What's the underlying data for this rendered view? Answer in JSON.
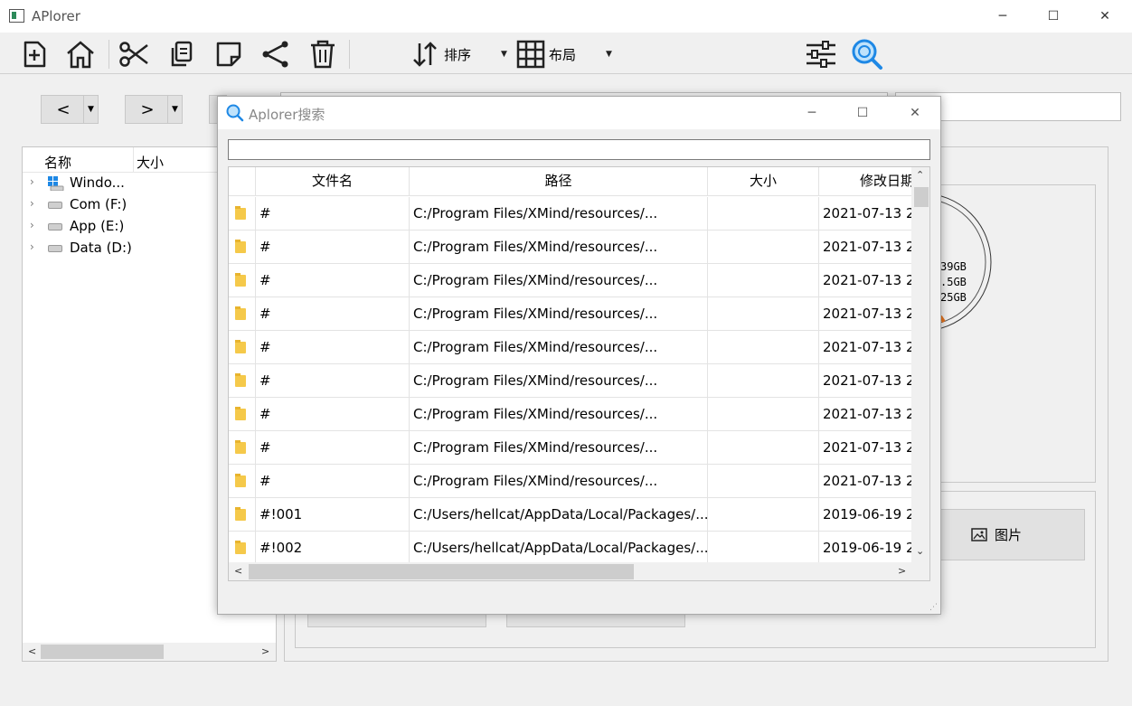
{
  "window": {
    "title": "APlorer",
    "minimize": "─",
    "maximize": "☐",
    "close": "✕"
  },
  "toolbar": {
    "icons": [
      "new-file-icon",
      "home-icon",
      "cut-icon",
      "copy-icon",
      "note-icon",
      "share-icon",
      "delete-icon",
      "sort-icon",
      "layout-grid-icon",
      "filter-settings-icon",
      "search-icon"
    ],
    "sort_label": "排序",
    "layout_label": "布局",
    "dropdown_glyph": "▼"
  },
  "nav": {
    "back": "<",
    "forward": ">",
    "dropdown_glyph": "▼"
  },
  "tree": {
    "headers": [
      "名称",
      "大小"
    ],
    "items": [
      {
        "label": "Windo...",
        "icon": "windows-drive-icon"
      },
      {
        "label": "Com (F:)",
        "icon": "drive-icon"
      },
      {
        "label": "App (E:)",
        "icon": "drive-icon"
      },
      {
        "label": "Data (D:)",
        "icon": "drive-icon"
      }
    ],
    "expand_glyph": "›"
  },
  "disk": {
    "values": [
      "39GB",
      ".5GB",
      "25GB"
    ]
  },
  "pictures_button": "图片",
  "search_dialog": {
    "title": "Aplorer搜索",
    "query": "",
    "columns": [
      "文件名",
      "路径",
      "大小",
      "修改日期"
    ],
    "rows": [
      {
        "name": "#",
        "path": "C:/Program Files/XMind/resources/...",
        "size": "",
        "date": "2021-07-13 2"
      },
      {
        "name": "#",
        "path": "C:/Program Files/XMind/resources/...",
        "size": "",
        "date": "2021-07-13 2"
      },
      {
        "name": "#",
        "path": "C:/Program Files/XMind/resources/...",
        "size": "",
        "date": "2021-07-13 2"
      },
      {
        "name": "#",
        "path": "C:/Program Files/XMind/resources/...",
        "size": "",
        "date": "2021-07-13 2"
      },
      {
        "name": "#",
        "path": "C:/Program Files/XMind/resources/...",
        "size": "",
        "date": "2021-07-13 2"
      },
      {
        "name": "#",
        "path": "C:/Program Files/XMind/resources/...",
        "size": "",
        "date": "2021-07-13 2"
      },
      {
        "name": "#",
        "path": "C:/Program Files/XMind/resources/...",
        "size": "",
        "date": "2021-07-13 2"
      },
      {
        "name": "#",
        "path": "C:/Program Files/XMind/resources/...",
        "size": "",
        "date": "2021-07-13 2"
      },
      {
        "name": "#",
        "path": "C:/Program Files/XMind/resources/...",
        "size": "",
        "date": "2021-07-13 2"
      },
      {
        "name": "#!001",
        "path": "C:/Users/hellcat/AppData/Local/Packages/...",
        "size": "",
        "date": "2019-06-19 2"
      },
      {
        "name": "#!002",
        "path": "C:/Users/hellcat/AppData/Local/Packages/...",
        "size": "",
        "date": "2019-06-19 2"
      }
    ]
  },
  "colors": {
    "accent": "#1e88e5",
    "folder": "#f5c94a",
    "window_bg": "#f0f0f0"
  }
}
